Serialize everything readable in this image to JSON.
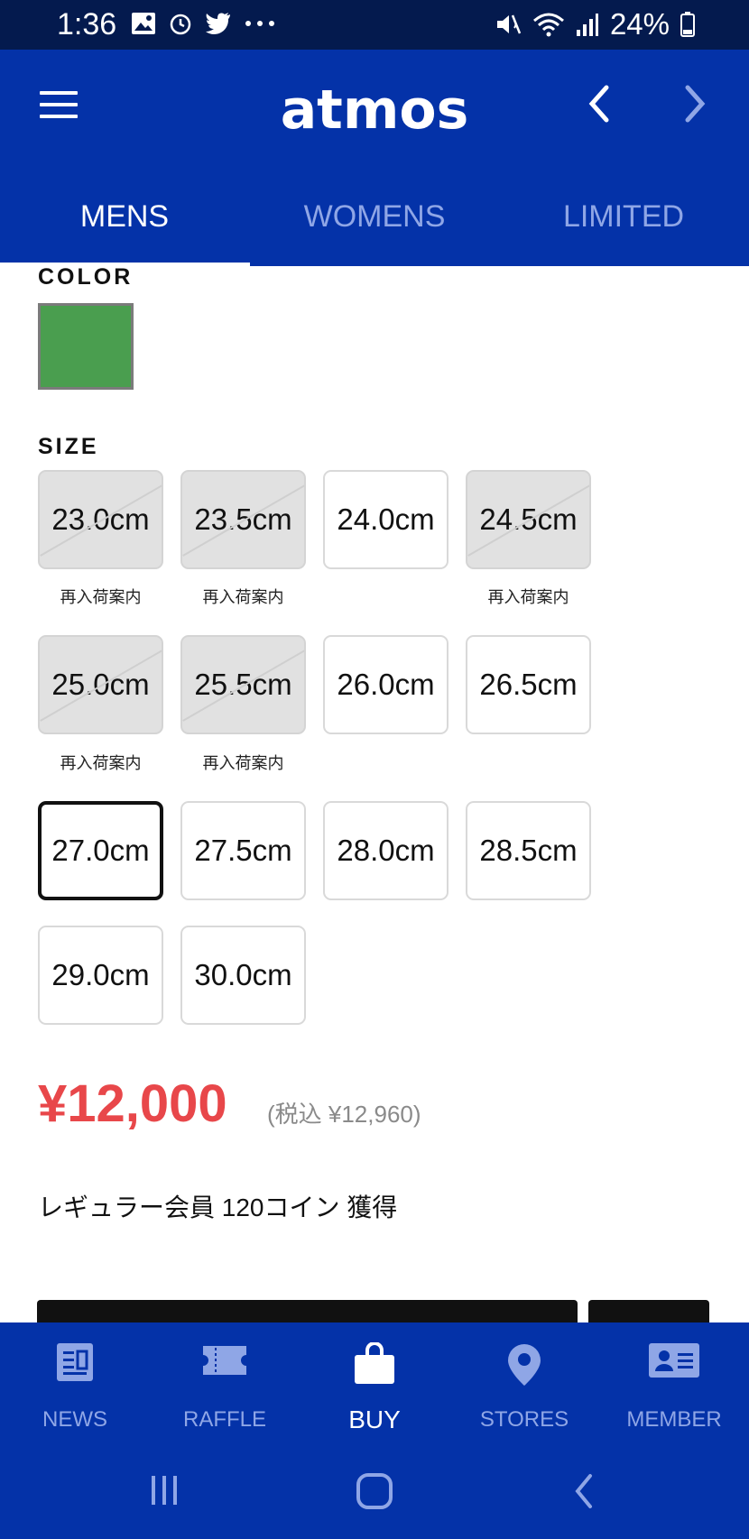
{
  "status_bar": {
    "time": "1:36",
    "battery": "24%"
  },
  "header": {
    "logo": "atmos"
  },
  "tabs": [
    {
      "label": "MENS",
      "active": true
    },
    {
      "label": "WOMENS",
      "active": false
    },
    {
      "label": "LIMITED",
      "active": false
    }
  ],
  "color_section": {
    "label": "COLOR",
    "swatch_color": "#4a9e4f"
  },
  "size_section": {
    "label": "SIZE",
    "restock_label": "再入荷案内",
    "sizes": [
      {
        "label": "23.0cm",
        "state": "soldout"
      },
      {
        "label": "23.5cm",
        "state": "soldout"
      },
      {
        "label": "24.0cm",
        "state": "available"
      },
      {
        "label": "24.5cm",
        "state": "soldout"
      },
      {
        "label": "25.0cm",
        "state": "soldout"
      },
      {
        "label": "25.5cm",
        "state": "soldout"
      },
      {
        "label": "26.0cm",
        "state": "available"
      },
      {
        "label": "26.5cm",
        "state": "available"
      },
      {
        "label": "27.0cm",
        "state": "selected"
      },
      {
        "label": "27.5cm",
        "state": "available"
      },
      {
        "label": "28.0cm",
        "state": "available"
      },
      {
        "label": "28.5cm",
        "state": "available"
      },
      {
        "label": "29.0cm",
        "state": "available"
      },
      {
        "label": "30.0cm",
        "state": "available"
      }
    ]
  },
  "price": {
    "amount": "¥12,000",
    "tax_included": "(税込 ¥12,960)"
  },
  "coin_text": "レギュラー会員 120コイン 獲得",
  "bottom_nav": [
    {
      "label": "NEWS",
      "icon": "news-icon",
      "active": false
    },
    {
      "label": "RAFFLE",
      "icon": "ticket-icon",
      "active": false
    },
    {
      "label": "BUY",
      "icon": "shopping-bag-icon",
      "active": true
    },
    {
      "label": "STORES",
      "icon": "location-pin-icon",
      "active": false
    },
    {
      "label": "MEMBER",
      "icon": "member-card-icon",
      "active": false
    }
  ],
  "colors": {
    "brand_blue": "#0432a8",
    "status_bar": "#041a4e",
    "price_red": "#e8474a"
  }
}
